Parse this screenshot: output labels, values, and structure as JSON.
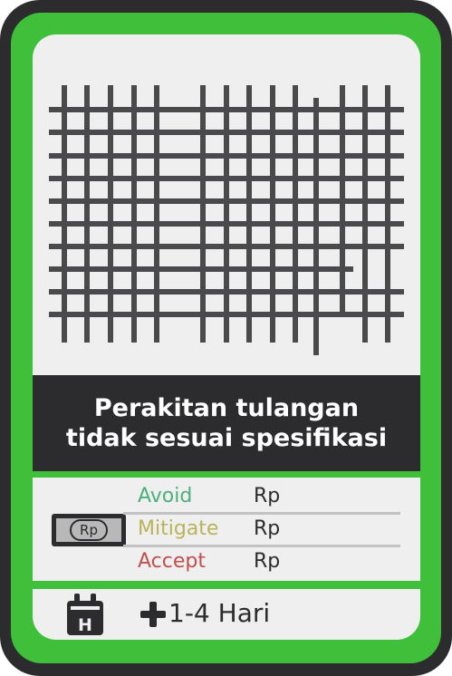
{
  "card": {
    "title_line1": "Perakitan tulangan",
    "title_line2": "tidak sesuai spesifikasi",
    "colors": {
      "frame": "#2c2c2e",
      "accent": "#3fbf3a",
      "panel": "#efefef",
      "avoid": "#4caf7d",
      "mitigate": "#b9b35a",
      "accept": "#c0504d"
    },
    "illustration_icon": "rebar-grid-icon"
  },
  "risk": {
    "badge_label": "Rp",
    "badge_icon": "money-icon",
    "options": [
      {
        "label": "Avoid",
        "value": "Rp"
      },
      {
        "label": "Mitigate",
        "value": "Rp"
      },
      {
        "label": "Accept",
        "value": "Rp"
      }
    ]
  },
  "time": {
    "icon": "calendar-icon",
    "calendar_letter": "H",
    "plus_icon": "plus-icon",
    "text": "1-4 Hari"
  }
}
